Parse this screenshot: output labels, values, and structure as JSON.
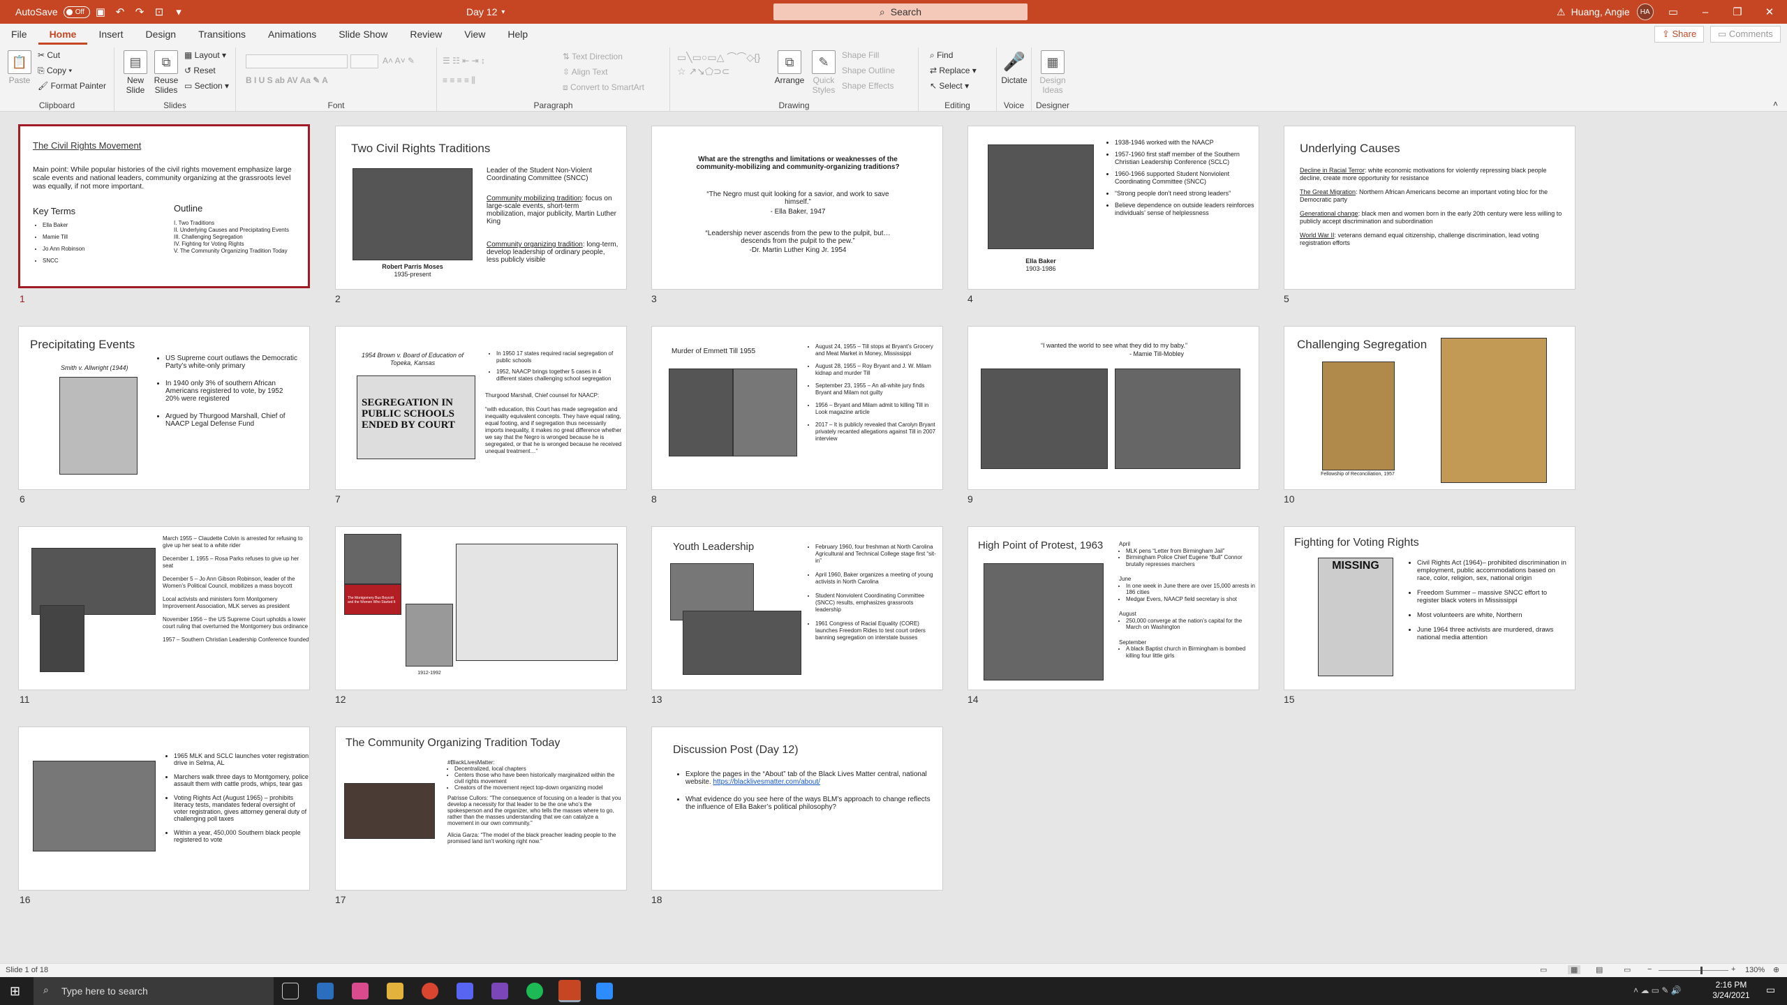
{
  "titlebar": {
    "autosave_label": "AutoSave",
    "autosave_state": "Off",
    "doc_title": "Day 12",
    "search_placeholder": "Search",
    "user_name": "Huang, Angie",
    "user_initials": "HA"
  },
  "ribbon": {
    "tabs": [
      "File",
      "Home",
      "Insert",
      "Design",
      "Transitions",
      "Animations",
      "Slide Show",
      "Review",
      "View",
      "Help"
    ],
    "share": "Share",
    "comments": "Comments",
    "clipboard": {
      "paste": "Paste",
      "cut": "Cut",
      "copy": "Copy",
      "format_painter": "Format Painter",
      "label": "Clipboard"
    },
    "slides": {
      "new_slide": "New Slide",
      "reuse": "Reuse Slides",
      "layout": "Layout",
      "reset": "Reset",
      "section": "Section",
      "label": "Slides"
    },
    "font": {
      "label": "Font"
    },
    "paragraph": {
      "text_direction": "Text Direction",
      "align_text": "Align Text",
      "smartart": "Convert to SmartArt",
      "label": "Paragraph"
    },
    "drawing": {
      "arrange": "Arrange",
      "quick_styles": "Quick Styles",
      "shape_fill": "Shape Fill",
      "shape_outline": "Shape Outline",
      "shape_effects": "Shape Effects",
      "label": "Drawing"
    },
    "editing": {
      "find": "Find",
      "replace": "Replace",
      "select": "Select",
      "label": "Editing"
    },
    "voice": {
      "dictate": "Dictate",
      "label": "Voice"
    },
    "designer": {
      "design_ideas": "Design Ideas",
      "label": "Designer"
    }
  },
  "slides": {
    "s1": {
      "title": "The Civil Rights Movement",
      "main": "Main point:  While popular histories of the civil rights movement emphasize large scale events and national leaders, community organizing at the grassroots level was equally, if not more important.",
      "kt_head": "Key Terms",
      "kt": [
        "Ella Baker",
        "Mamie Till",
        "Jo Ann Robinson",
        "SNCC"
      ],
      "ol_head": "Outline",
      "ol": [
        "I.    Two Traditions",
        "II.   Underlying Causes and Precipitating Events",
        "III.  Challenging Segregation",
        "IV.  Fighting for Voting Rights",
        "V.   The Community Organizing Tradition Today"
      ]
    },
    "s2": {
      "title": "Two Civil Rights Traditions",
      "caption1": "Robert Parris Moses",
      "caption2": "1935-present",
      "p1": "Leader of the Student Non-Violent Coordinating Committee (SNCC)",
      "p2h": "Community mobilizing tradition",
      "p2": ": focus on large-scale events, short-term mobilization, major publicity, Martin Luther King",
      "p3h": "Community organizing tradition",
      "p3": ": long-term, develop leadership of ordinary people, less publicly visible"
    },
    "s3": {
      "q": "What are the strengths and limitations or weaknesses of the community-mobilizing and community-organizing traditions?",
      "quote1": "“The Negro must quit looking for a savior, and work to save himself.”",
      "attr1": "-  Ella Baker, 1947",
      "quote2": "“Leadership never ascends from the pew to the pulpit, but…descends from the pulpit to the pew.”",
      "attr2": "-Dr. Martin Luther King Jr. 1954"
    },
    "s4": {
      "bullets": [
        "1938-1946 worked with the NAACP",
        "1957-1960 first staff member of the Southern Christian Leadership Conference (SCLC)",
        "1960-1966 supported Student Nonviolent Coordinating Committee (SNCC)",
        "“Strong people don’t need strong leaders”",
        "Believe dependence on outside leaders reinforces individuals’ sense of helplessness"
      ],
      "caption1": "Ella Baker",
      "caption2": "1903-1986"
    },
    "s5": {
      "title": "Underlying Causes",
      "items": [
        {
          "h": "Decline in Racial Terror",
          "t": ": white economic motivations for violently repressing black people decline, create more opportunity for resistance"
        },
        {
          "h": "The Great Migration",
          "t": ": Northern African Americans become an important voting bloc for the Democratic party"
        },
        {
          "h": "Generational change",
          "t": ": black men and women born in the early 20th century were less willing to publicly accept discrimination and subordination"
        },
        {
          "h": "World War II",
          "t": ": veterans demand equal citizenship, challenge discrimination, lead voting registration efforts"
        }
      ]
    },
    "s6": {
      "title": "Precipitating Events",
      "case": "Smith v. Allwright (1944)",
      "bullets": [
        "US Supreme court outlaws the Democratic Party’s white-only primary",
        "In 1940 only 3% of southern African Americans registered to vote, by 1952 20% were registered",
        "Argued by Thurgood Marshall, Chief of NAACP Legal Defense Fund"
      ]
    },
    "s7": {
      "case": "1954 Brown v. Board of Education of Topeka, Kansas",
      "headline": "SEGREGATION IN PUBLIC SCHOOLS ENDED BY COURT",
      "bullets": [
        "In 1950 17 states required racial segregation of public schools",
        "1952, NAACP brings together 5 cases in 4 different states challenging school segregation"
      ],
      "marshall": "Thurgood Marshall, Chief counsel for NAACP:",
      "quote": "“with education, this Court has made segregation and inequality equivalent concepts. They have equal rating, equal footing, and if segregation thus necessarily imports inequality, it makes no great difference whether we say that the Negro is wronged because he is segregated, or that he is wronged because he received unequal treatment…”"
    },
    "s8": {
      "title": "Murder of Emmett Till 1955",
      "bullets": [
        "August 24, 1955 – Till stops at Bryant’s Grocery and Meat Market in Money, Mississippi",
        "August 28, 1955 – Roy Bryant and J. W. Milam kidnap and murder Till",
        "September 23, 1955 – An all-white jury finds Bryant and Milam not guilty",
        "1956 – Bryant and Milam admit to killing Till in Look magazine article",
        "2017 – It is publicly revealed that Carolyn Bryant privately recanted allegations against Till in 2007 interview"
      ]
    },
    "s9": {
      "quote": "“I wanted the world to see what they did to my baby.”",
      "attr": "- Mamie Till-Mobley"
    },
    "s10": {
      "title": "Challenging Segregation",
      "caption": "Fellowship of Reconciliation, 1957"
    },
    "s11": {
      "items": [
        "March 1955 – Claudette Colvin is arrested for refusing to give up her seat to a white rider",
        "December 1, 1955 – Rosa Parks refuses to give up her seat",
        "December 5 – Jo Ann Gibson Robinson, leader of the Women’s Political Council, mobilizes a mass boycott",
        "Local activists and ministers form Montgomery Improvement Association, MLK serves as president",
        "November 1956 – the US Supreme Court upholds a lower court ruling that overturned the Montgomery bus ordinance",
        "1957 – Southern Christian Leadership Conference founded"
      ]
    },
    "s12": {
      "caption": "1912-1992",
      "book": "The Montgomery Bus Boycott and the Women Who Started It"
    },
    "s13": {
      "title": "Youth Leadership",
      "bullets": [
        "February 1960, four freshman at North Carolina Agricultural and Technical College stage first “sit-in”",
        "April 1960, Baker organizes a meeting of young activists in North Carolina",
        "Student Nonviolent Coordinating Committee (SNCC) results, emphasizes grassroots leadership",
        "1961 Congress of Racial Equality (CORE) launches Freedom Rides to test court orders banning segregation on interstate busses"
      ]
    },
    "s14": {
      "title": "High Point of Protest, 1963",
      "sections": [
        {
          "h": "April",
          "b": [
            "MLK pens “Letter from Birmingham Jail”",
            "Birmingham Police Chief Eugene “Bull” Connor brutally represses marchers"
          ]
        },
        {
          "h": "June",
          "b": [
            "In one week in June there are over 15,000 arrests in 186 cities",
            "Medgar Evers, NAACP field secretary is shot"
          ]
        },
        {
          "h": "August",
          "b": [
            "250,000 converge at the nation’s capital for the March on Washington"
          ]
        },
        {
          "h": "September",
          "b": [
            "A black Baptist church in Birmingham is bombed killing four little girls"
          ]
        }
      ]
    },
    "s15": {
      "title": "Fighting for Voting Rights",
      "poster": "MISSING",
      "bullets": [
        "Civil Rights Act (1964)– prohibited discrimination in employment, public accommodations based on race, color, religion, sex, national origin",
        "Freedom Summer – massive SNCC effort to register black voters in Mississippi",
        "Most volunteers are white, Northern",
        "June 1964 three activists are murdered, draws national media attention"
      ]
    },
    "s16": {
      "bullets": [
        "1965 MLK and SCLC launches voter registration drive in Selma, AL",
        "Marchers walk three days to Montgomery, police assault them with cattle prods, whips, tear gas",
        "Voting Rights Act (August 1965) – prohibits literacy tests, mandates federal oversight of voter registration, gives attorney general duty of challenging poll taxes",
        "Within a year, 450,000 Southern black people registered to vote"
      ]
    },
    "s17": {
      "title": "The Community Organizing Tradition Today",
      "tag": "#BlackLivesMatter:",
      "bullets": [
        "Decentralized, local chapters",
        "Centers those who have been historically marginalized within the civil rights movement",
        "Creators of the movement reject top-down organizing model"
      ],
      "quote1": "Patrisse Cullors: “The consequence of focusing on a leader is that you develop a necessity for that leader to be the one who’s the spokesperson and the organizer, who tells the masses where to go, rather than the masses understanding that we can catalyze a movement in our own community.”",
      "quote2": "Alicia Garza: “The model of the black preacher leading people to the promised land isn’t working right now.”"
    },
    "s18": {
      "title": "Discussion Post (Day 12)",
      "b1": "Explore the pages in the “About” tab of the Black Lives Matter central, national website.",
      "link": "https://blacklivesmatter.com/about/",
      "b2": "What evidence do you see here of the ways BLM’s approach to change reflects the influence of Ella Baker’s political philosophy?"
    },
    "numbers": [
      "1",
      "2",
      "3",
      "4",
      "5",
      "6",
      "7",
      "8",
      "9",
      "10",
      "11",
      "12",
      "13",
      "14",
      "15",
      "16",
      "17",
      "18"
    ]
  },
  "status": {
    "slide_of": "Slide 1 of 18",
    "zoom": "130%"
  },
  "taskbar": {
    "search_placeholder": "Type here to search",
    "time": "2:16 PM",
    "date": "3/24/2021"
  }
}
